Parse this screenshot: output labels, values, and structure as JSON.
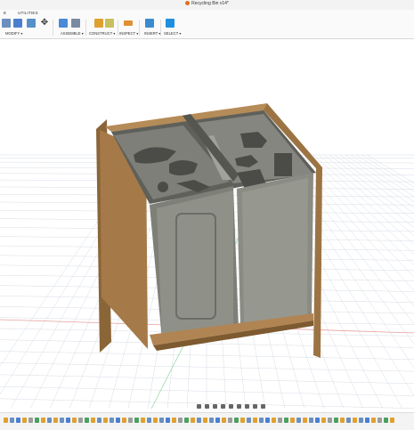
{
  "window": {
    "title": "Recycling Bin v14*"
  },
  "tabs": [
    "UTILITIES"
  ],
  "toolbar": {
    "groups": [
      {
        "label": "MODIFY ▾"
      },
      {
        "label": "ASSEMBLE ▾"
      },
      {
        "label": "CONSTRUCT ▾"
      },
      {
        "label": "INSPECT ▾"
      },
      {
        "label": "INSERT ▾"
      },
      {
        "label": "SELECT ▾"
      }
    ]
  },
  "colors": {
    "accent": "#1e8fe0",
    "wood": "#a57a48",
    "wood_dark": "#7e5a30",
    "bin_gray": "#8f9188",
    "grid": "#c8cfd8",
    "axis_red": "#e07b7b",
    "axis_green": "#7bc98a"
  },
  "icons": [
    "move-icon",
    "joint-icon",
    "plane-icon",
    "measure-icon",
    "insert-image-icon",
    "select-arrow-icon",
    "orbit-icon",
    "zoom-icon",
    "display-settings-icon",
    "grid-icon",
    "timeline-play-icon"
  ]
}
